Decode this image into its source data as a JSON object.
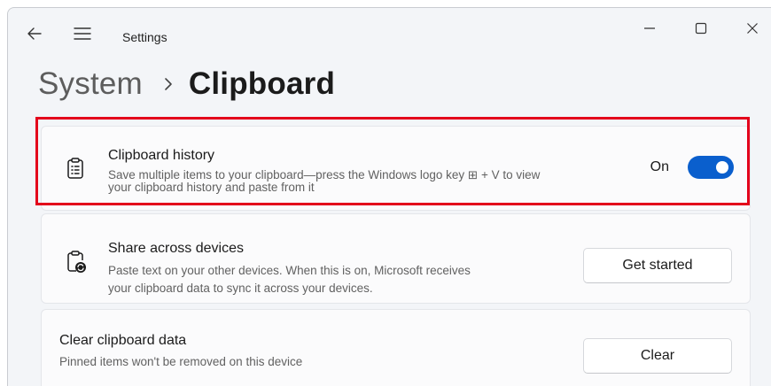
{
  "titlebar": {
    "title": "Settings",
    "back_icon": "back-arrow-icon",
    "menu_icon": "hamburger-menu-icon",
    "controls": [
      "minimize-icon",
      "maximize-icon",
      "close-icon"
    ]
  },
  "breadcrumb": {
    "parent": "System",
    "separator_icon": "chevron-right-icon",
    "current": "Clipboard"
  },
  "cards": {
    "history": {
      "icon": "clipboard-list-icon",
      "title": "Clipboard history",
      "desc_line1": "Save multiple items to your clipboard—press the Windows logo key ⊞ + V to view",
      "desc_line2": "your clipboard history and paste from it",
      "toggle_label": "On",
      "toggle_state": true,
      "highlight_color": "#e3001b"
    },
    "share": {
      "icon": "clipboard-sync-icon",
      "title": "Share across devices",
      "desc_line1": "Paste text on your other devices. When this is on, Microsoft receives",
      "desc_line2": "your clipboard data to sync it across your devices.",
      "button_label": "Get started"
    },
    "clear": {
      "title": "Clear clipboard data",
      "desc": "Pinned items won't be removed on this device",
      "button_label": "Clear"
    }
  },
  "colors": {
    "accent": "#0a5fcd",
    "window_bg": "#f3f5f8",
    "card_bg": "#fbfbfc"
  }
}
